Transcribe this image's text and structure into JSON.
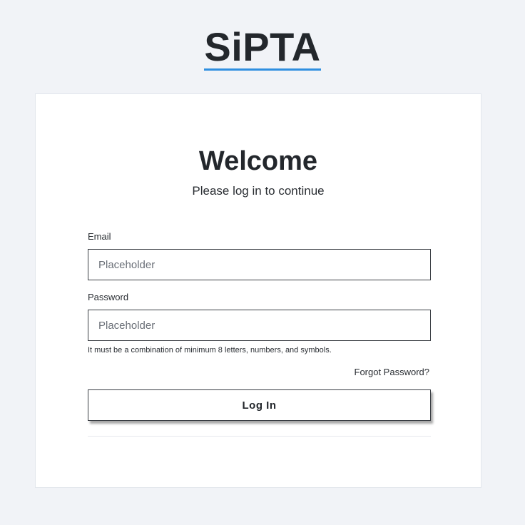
{
  "brand": {
    "logo_text": "SiPTA",
    "accent_color": "#2f8fe0"
  },
  "login": {
    "title": "Welcome",
    "subtitle": "Please log in to continue",
    "email": {
      "label": "Email",
      "placeholder": "Placeholder",
      "value": ""
    },
    "password": {
      "label": "Password",
      "placeholder": "Placeholder",
      "value": "",
      "hint": "It must be a combination of minimum 8 letters, numbers, and symbols."
    },
    "forgot_password": "Forgot Password?",
    "submit_label": "Log In"
  }
}
